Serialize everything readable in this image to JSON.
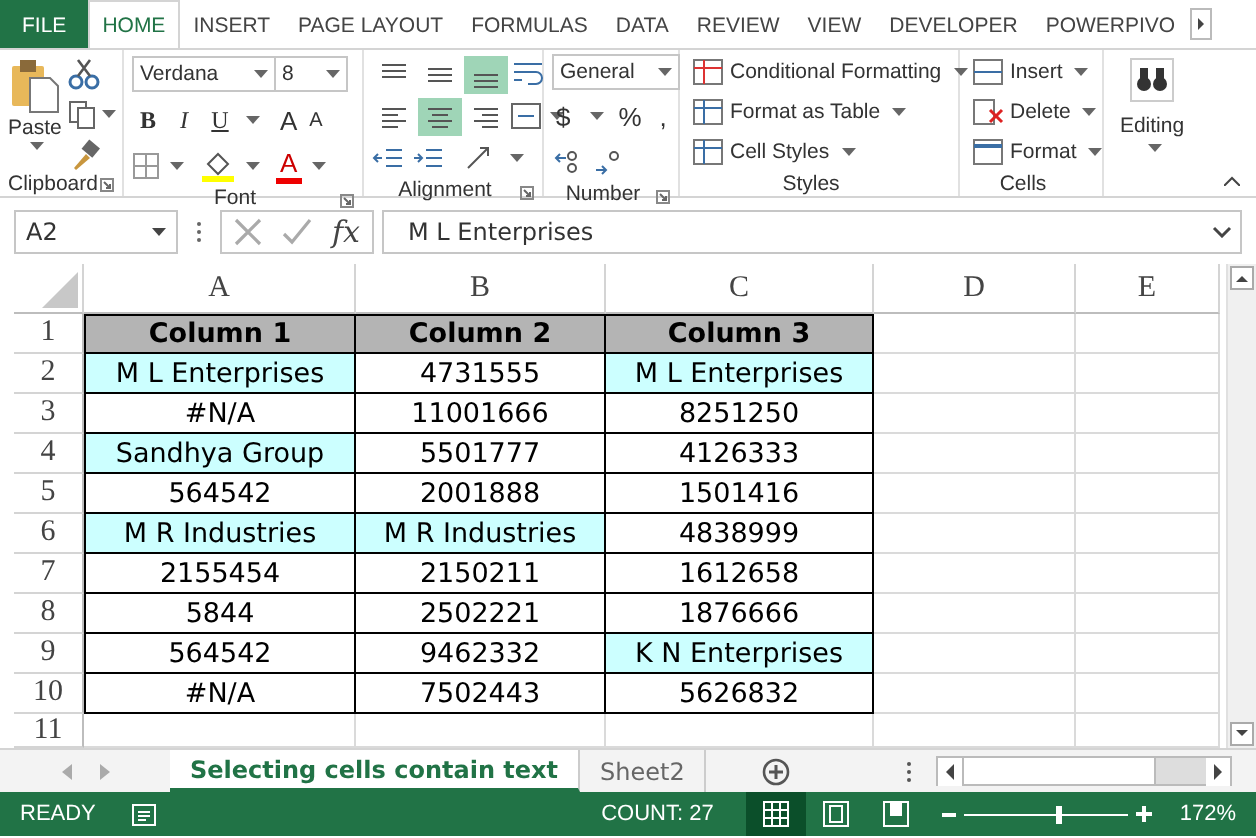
{
  "ribbon_tabs": [
    {
      "label": "FILE",
      "kind": "file",
      "selected": false
    },
    {
      "label": "HOME",
      "kind": "tab",
      "selected": true
    },
    {
      "label": "INSERT",
      "kind": "tab",
      "selected": false
    },
    {
      "label": "PAGE LAYOUT",
      "kind": "tab",
      "selected": false
    },
    {
      "label": "FORMULAS",
      "kind": "tab",
      "selected": false
    },
    {
      "label": "DATA",
      "kind": "tab",
      "selected": false
    },
    {
      "label": "REVIEW",
      "kind": "tab",
      "selected": false
    },
    {
      "label": "VIEW",
      "kind": "tab",
      "selected": false
    },
    {
      "label": "DEVELOPER",
      "kind": "tab",
      "selected": false
    },
    {
      "label": "POWERPIVO",
      "kind": "tab",
      "selected": false
    }
  ],
  "ribbon": {
    "clipboard": {
      "label": "Clipboard",
      "paste": "Paste",
      "launcher": true
    },
    "font": {
      "label": "Font",
      "name": "Verdana",
      "size": "8",
      "styles": [
        "B",
        "I",
        "U"
      ],
      "grow": "A",
      "shrink": "A",
      "font_color": "A",
      "launcher": true
    },
    "alignment": {
      "label": "Alignment",
      "launcher": true,
      "buttons": [
        {
          "kind": "top",
          "selected": false
        },
        {
          "kind": "middle",
          "selected": false
        },
        {
          "kind": "bottom",
          "selected": true
        },
        {
          "kind": "left",
          "selected": false
        },
        {
          "kind": "center",
          "selected": true
        },
        {
          "kind": "right",
          "selected": false
        }
      ]
    },
    "number": {
      "label": "Number",
      "format": "General",
      "symbols": [
        "$",
        "%",
        ","
      ],
      "launcher": true
    },
    "styles": {
      "label": "Styles",
      "items": [
        {
          "label": "Conditional Formatting"
        },
        {
          "label": "Format as Table"
        },
        {
          "label": "Cell Styles"
        }
      ]
    },
    "cells": {
      "label": "Cells",
      "items": [
        {
          "label": "Insert",
          "kind": "insert"
        },
        {
          "label": "Delete",
          "kind": "delete"
        },
        {
          "label": "Format",
          "kind": "format"
        }
      ]
    },
    "editing": {
      "label": "Editing"
    }
  },
  "formula_bar": {
    "name_box": "A2",
    "function_button": "fx",
    "value": "M L Enterprises"
  },
  "sheet": {
    "columns": [
      "A",
      "B",
      "C",
      "D",
      "E"
    ],
    "rows": [
      {
        "number": "1",
        "cells": [
          {
            "text": "Column 1",
            "kind": "header"
          },
          {
            "text": "Column 2",
            "kind": "header"
          },
          {
            "text": "Column 3",
            "kind": "header"
          }
        ]
      },
      {
        "number": "2",
        "cells": [
          {
            "text": "M L Enterprises",
            "kind": "highlight"
          },
          {
            "text": "4731555",
            "kind": "plain"
          },
          {
            "text": "M L Enterprises",
            "kind": "highlight"
          }
        ]
      },
      {
        "number": "3",
        "cells": [
          {
            "text": "#N/A",
            "kind": "plain"
          },
          {
            "text": "11001666",
            "kind": "plain"
          },
          {
            "text": "8251250",
            "kind": "plain"
          }
        ]
      },
      {
        "number": "4",
        "cells": [
          {
            "text": "Sandhya Group",
            "kind": "highlight"
          },
          {
            "text": "5501777",
            "kind": "plain"
          },
          {
            "text": "4126333",
            "kind": "plain"
          }
        ]
      },
      {
        "number": "5",
        "cells": [
          {
            "text": "564542",
            "kind": "plain"
          },
          {
            "text": "2001888",
            "kind": "plain"
          },
          {
            "text": "1501416",
            "kind": "plain"
          }
        ]
      },
      {
        "number": "6",
        "cells": [
          {
            "text": "M R Industries",
            "kind": "highlight"
          },
          {
            "text": "M R Industries",
            "kind": "highlight"
          },
          {
            "text": "4838999",
            "kind": "plain"
          }
        ]
      },
      {
        "number": "7",
        "cells": [
          {
            "text": "2155454",
            "kind": "plain"
          },
          {
            "text": "2150211",
            "kind": "plain"
          },
          {
            "text": "1612658",
            "kind": "plain"
          }
        ]
      },
      {
        "number": "8",
        "cells": [
          {
            "text": "5844",
            "kind": "plain"
          },
          {
            "text": "2502221",
            "kind": "plain"
          },
          {
            "text": "1876666",
            "kind": "plain"
          }
        ]
      },
      {
        "number": "9",
        "cells": [
          {
            "text": "564542",
            "kind": "plain"
          },
          {
            "text": "9462332",
            "kind": "plain"
          },
          {
            "text": "K N Enterprises",
            "kind": "highlight"
          }
        ]
      },
      {
        "number": "10",
        "cells": [
          {
            "text": "#N/A",
            "kind": "plain"
          },
          {
            "text": "7502443",
            "kind": "plain"
          },
          {
            "text": "5626832",
            "kind": "plain"
          }
        ]
      },
      {
        "number": "11",
        "cells": []
      }
    ]
  },
  "sheet_tabs": [
    {
      "label": "Selecting cells contain text",
      "selected": true
    },
    {
      "label": "Sheet2",
      "selected": false
    }
  ],
  "status_bar": {
    "mode": "READY",
    "count": "COUNT: 27",
    "zoom": "172%",
    "zoom_slider": {
      "level": 0.57
    },
    "views": [
      {
        "kind": "normal",
        "selected": true
      },
      {
        "kind": "page_layout",
        "selected": false
      },
      {
        "kind": "page_break",
        "selected": false
      }
    ]
  }
}
